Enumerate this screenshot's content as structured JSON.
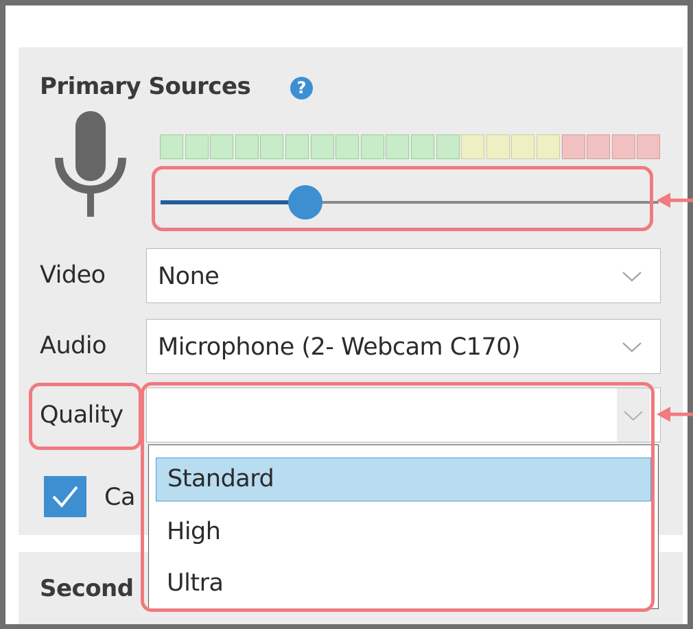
{
  "primary_sources": {
    "title": "Primary Sources",
    "help_icon": "question-circle-icon",
    "help_glyph": "?"
  },
  "microphone": {
    "icon": "microphone-icon",
    "level_meter": {
      "segments_green": 12,
      "segments_yellow": 4,
      "segments_red": 4,
      "colors": {
        "green": "#c8ebc8",
        "yellow": "#efefc4",
        "red": "#f1c1c1"
      }
    },
    "volume_slider": {
      "value_fraction": 0.29,
      "fill_color": "#1f5f99",
      "thumb_color": "#3d8fd2"
    }
  },
  "video": {
    "label": "Video",
    "value": "None",
    "icon": "chevron-down-icon"
  },
  "audio": {
    "label": "Audio",
    "value": "Microphone (2- Webcam C170)",
    "icon": "chevron-down-icon"
  },
  "quality": {
    "label": "Quality",
    "value": "",
    "icon": "chevron-down-icon",
    "options": [
      "Standard",
      "High",
      "Ultra"
    ],
    "selected_option": "Standard"
  },
  "camera_checkbox": {
    "checked": true,
    "label_visible": "Ca",
    "icon": "checkmark-icon"
  },
  "secondary_sources": {
    "title_visible": "Second"
  },
  "annotations": {
    "highlight_color": "#f07a7f",
    "arrow_icon": "arrow-left-icon"
  },
  "colors": {
    "accent": "#3d8fd2",
    "panel": "#ececec",
    "frame": "#6f6f6f"
  }
}
